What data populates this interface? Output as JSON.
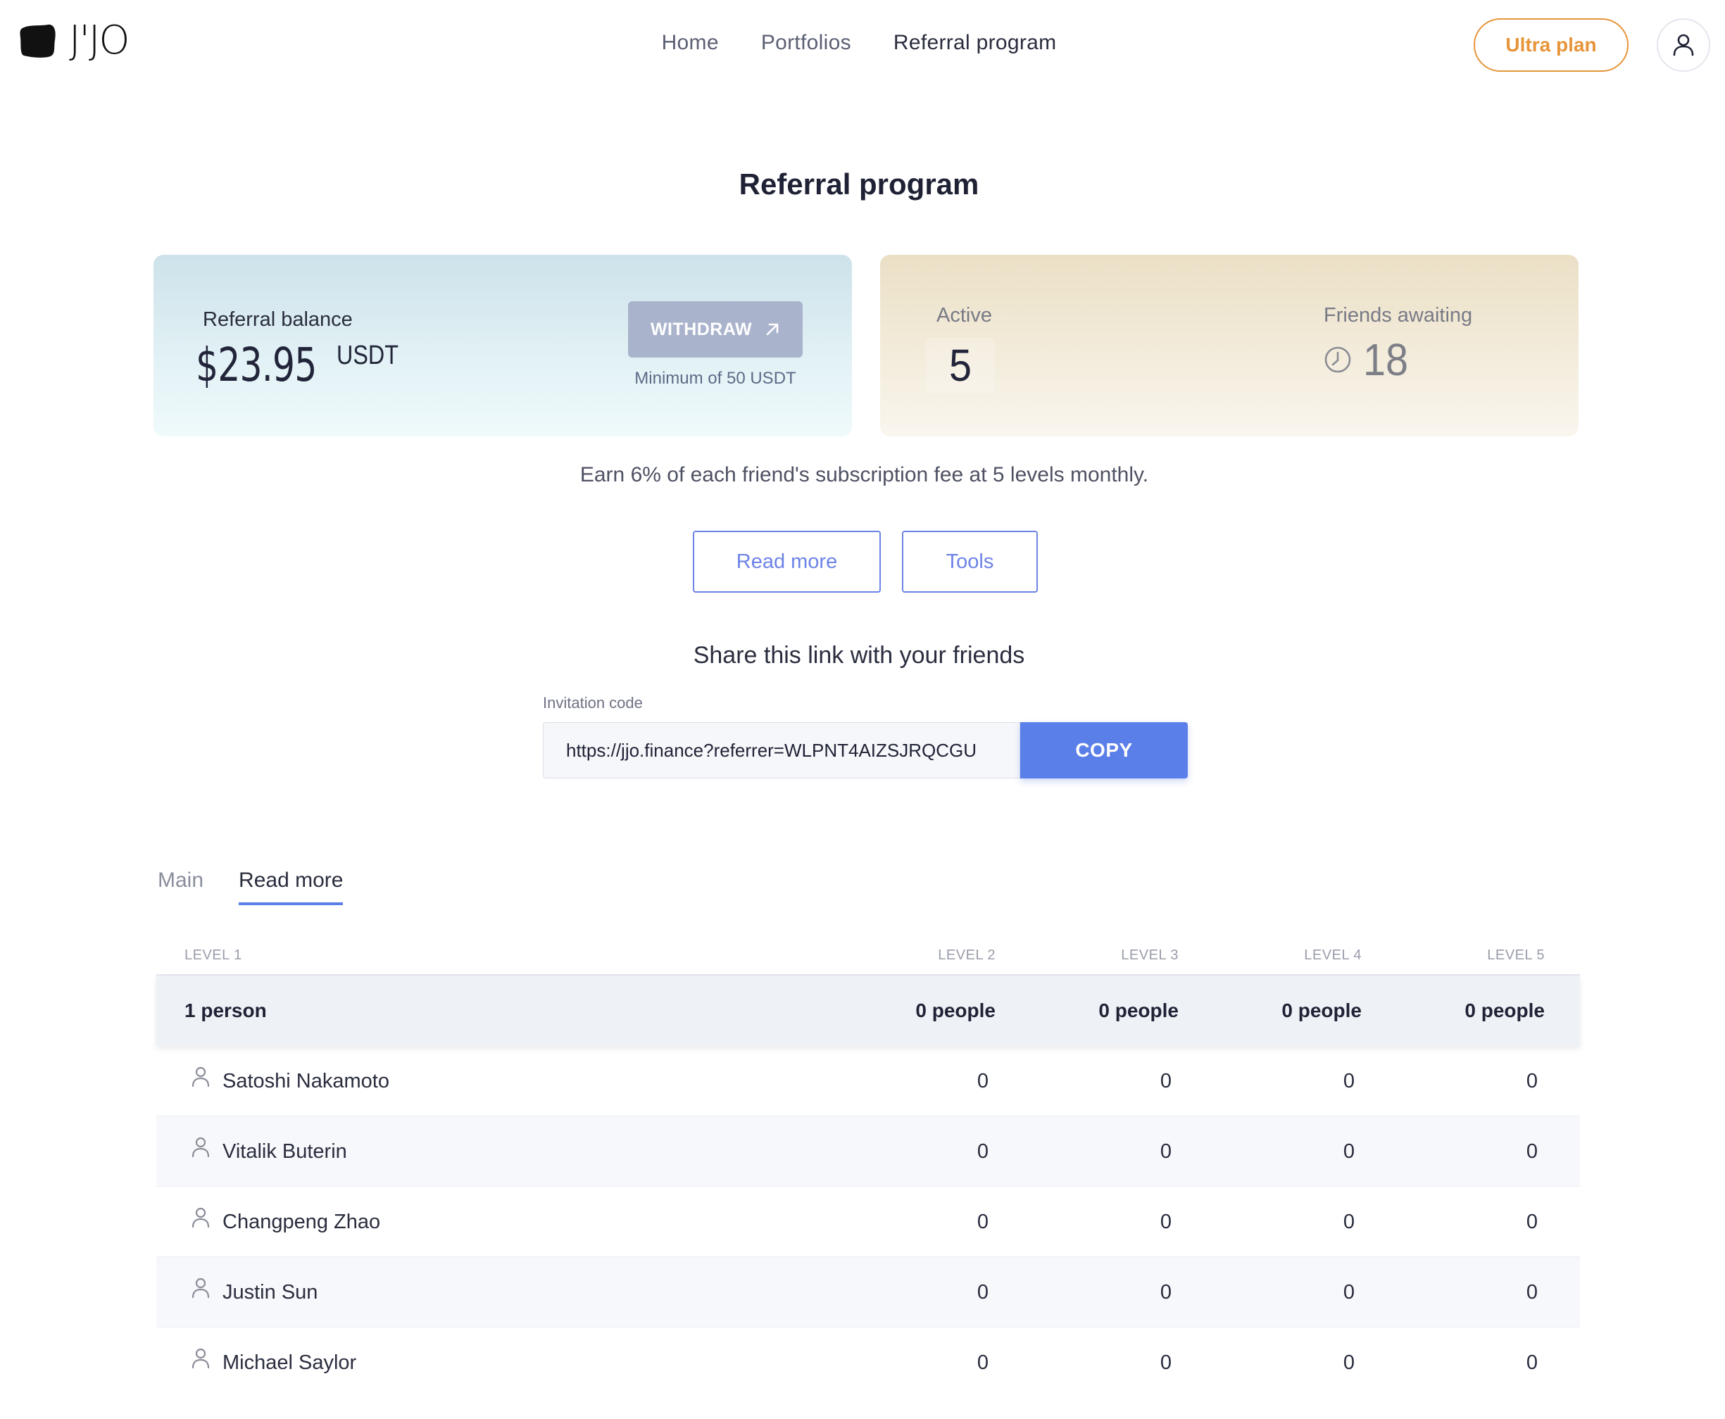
{
  "header": {
    "logo_text": "J'JO",
    "nav": [
      {
        "label": "Home"
      },
      {
        "label": "Portfolios"
      },
      {
        "label": "Referral program"
      }
    ],
    "ultra_label": "Ultra plan"
  },
  "page": {
    "title": "Referral program"
  },
  "balance_card": {
    "label": "Referral balance",
    "amount": "$23.95",
    "currency": "USDT",
    "withdraw_label": "WITHDRAW",
    "min_note": "Minimum of 50 USDT"
  },
  "friends_card": {
    "active_label": "Active",
    "active_value": "5",
    "awaiting_label": "Friends awaiting",
    "awaiting_value": "18"
  },
  "earn_text": "Earn 6% of each friend's subscription fee at 5 levels monthly.",
  "buttons": {
    "read_more": "Read more",
    "tools": "Tools"
  },
  "share": {
    "title": "Share this link with your friends",
    "invitation_label": "Invitation code",
    "invitation_value": "https://jjo.finance?referrer=WLPNT4AIZSJRQCGU",
    "copy_label": "COPY"
  },
  "tabs": [
    {
      "label": "Main",
      "active": false
    },
    {
      "label": "Read more",
      "active": true
    }
  ],
  "table": {
    "headers": [
      "LEVEL 1",
      "LEVEL 2",
      "LEVEL 3",
      "LEVEL 4",
      "LEVEL 5"
    ],
    "summary": [
      "1 person",
      "0 people",
      "0 people",
      "0 people",
      "0 people"
    ],
    "rows": [
      {
        "name": "Satoshi Nakamoto",
        "l2": "0",
        "l3": "0",
        "l4": "0",
        "l5": "0"
      },
      {
        "name": "Vitalik Buterin",
        "l2": "0",
        "l3": "0",
        "l4": "0",
        "l5": "0"
      },
      {
        "name": "Changpeng Zhao",
        "l2": "0",
        "l3": "0",
        "l4": "0",
        "l5": "0"
      },
      {
        "name": "Justin Sun",
        "l2": "0",
        "l3": "0",
        "l4": "0",
        "l5": "0"
      },
      {
        "name": "Michael Saylor",
        "l2": "0",
        "l3": "0",
        "l4": "0",
        "l5": "0"
      }
    ]
  },
  "icons": {
    "logo": "logo-mark-icon",
    "user": "user-icon",
    "withdraw": "arrow-up-right-icon",
    "awaiting": "clock-icon",
    "row_person": "person-icon"
  },
  "colors": {
    "accent": "#5b7fe8",
    "ultra": "#e6953a",
    "withdraw_disabled": "#a9b3cc"
  }
}
